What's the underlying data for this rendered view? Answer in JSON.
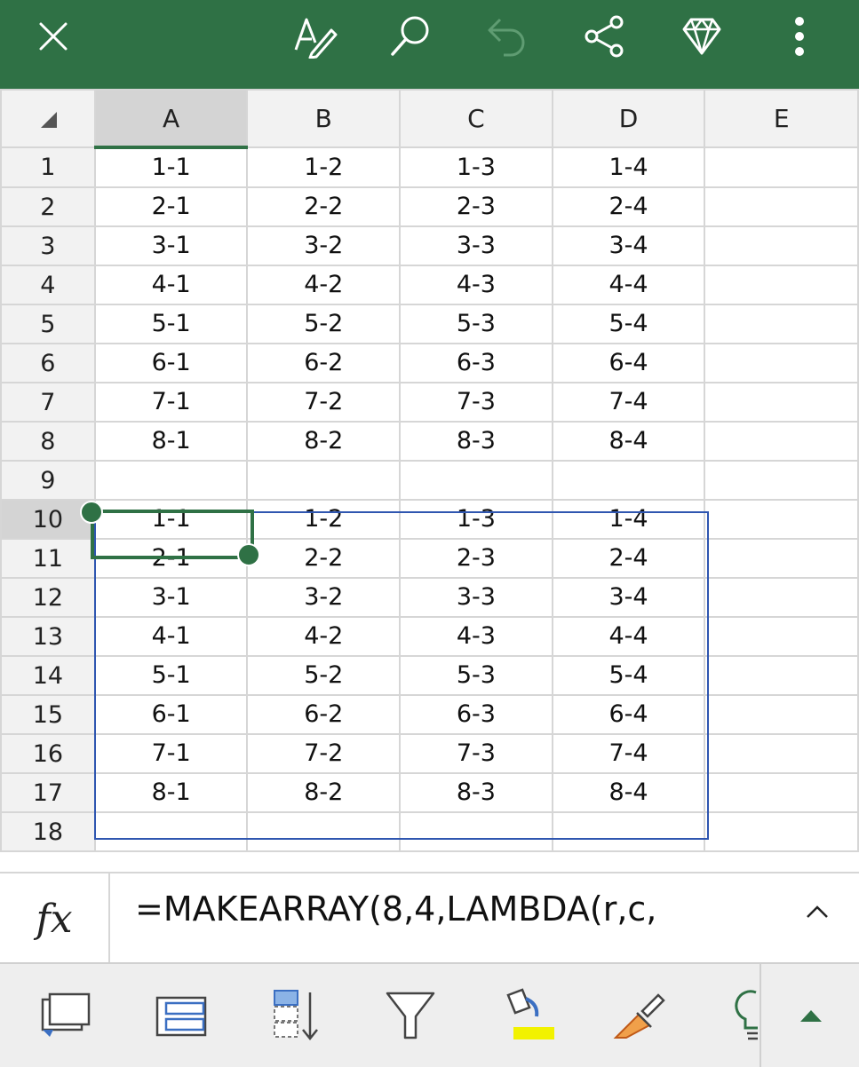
{
  "toolbar": {
    "icons": [
      "close-icon",
      "pen-icon",
      "search-icon",
      "undo-icon",
      "share-icon",
      "premium-diamond-icon",
      "more-vertical-icon"
    ],
    "accent_color": "#2f7145"
  },
  "grid": {
    "columns": [
      "A",
      "B",
      "C",
      "D",
      "E"
    ],
    "active_column": "A",
    "active_row": "10",
    "rows": [
      {
        "num": "1",
        "cells": [
          "1-1",
          "1-2",
          "1-3",
          "1-4",
          ""
        ]
      },
      {
        "num": "2",
        "cells": [
          "2-1",
          "2-2",
          "2-3",
          "2-4",
          ""
        ]
      },
      {
        "num": "3",
        "cells": [
          "3-1",
          "3-2",
          "3-3",
          "3-4",
          ""
        ]
      },
      {
        "num": "4",
        "cells": [
          "4-1",
          "4-2",
          "4-3",
          "4-4",
          ""
        ]
      },
      {
        "num": "5",
        "cells": [
          "5-1",
          "5-2",
          "5-3",
          "5-4",
          ""
        ]
      },
      {
        "num": "6",
        "cells": [
          "6-1",
          "6-2",
          "6-3",
          "6-4",
          ""
        ]
      },
      {
        "num": "7",
        "cells": [
          "7-1",
          "7-2",
          "7-3",
          "7-4",
          ""
        ]
      },
      {
        "num": "8",
        "cells": [
          "8-1",
          "8-2",
          "8-3",
          "8-4",
          ""
        ]
      },
      {
        "num": "9",
        "cells": [
          "",
          "",
          "",
          "",
          ""
        ]
      },
      {
        "num": "10",
        "cells": [
          "1-1",
          "1-2",
          "1-3",
          "1-4",
          ""
        ]
      },
      {
        "num": "11",
        "cells": [
          "2-1",
          "2-2",
          "2-3",
          "2-4",
          ""
        ]
      },
      {
        "num": "12",
        "cells": [
          "3-1",
          "3-2",
          "3-3",
          "3-4",
          ""
        ]
      },
      {
        "num": "13",
        "cells": [
          "4-1",
          "4-2",
          "4-3",
          "4-4",
          ""
        ]
      },
      {
        "num": "14",
        "cells": [
          "5-1",
          "5-2",
          "5-3",
          "5-4",
          ""
        ]
      },
      {
        "num": "15",
        "cells": [
          "6-1",
          "6-2",
          "6-3",
          "6-4",
          ""
        ]
      },
      {
        "num": "16",
        "cells": [
          "7-1",
          "7-2",
          "7-3",
          "7-4",
          ""
        ]
      },
      {
        "num": "17",
        "cells": [
          "8-1",
          "8-2",
          "8-3",
          "8-4",
          ""
        ]
      },
      {
        "num": "18",
        "cells": [
          "",
          "",
          "",
          "",
          ""
        ]
      }
    ],
    "selection_color": "#2f7145",
    "spill_range_color": "#2f56b0"
  },
  "formula_bar": {
    "fx_label": "fx",
    "formula": "=MAKEARRAY(8,4,LAMBDA(r,c,",
    "expand_icon": "chevron-up-icon"
  },
  "bottom_toolbar": {
    "icons": [
      "freeze-panes-icon",
      "merge-cells-icon",
      "sort-icon",
      "filter-icon",
      "fill-color-icon",
      "format-brush-icon",
      "ideas-lightbulb-icon",
      "expand-ribbon-icon"
    ],
    "fill_color": "#f2f200"
  }
}
